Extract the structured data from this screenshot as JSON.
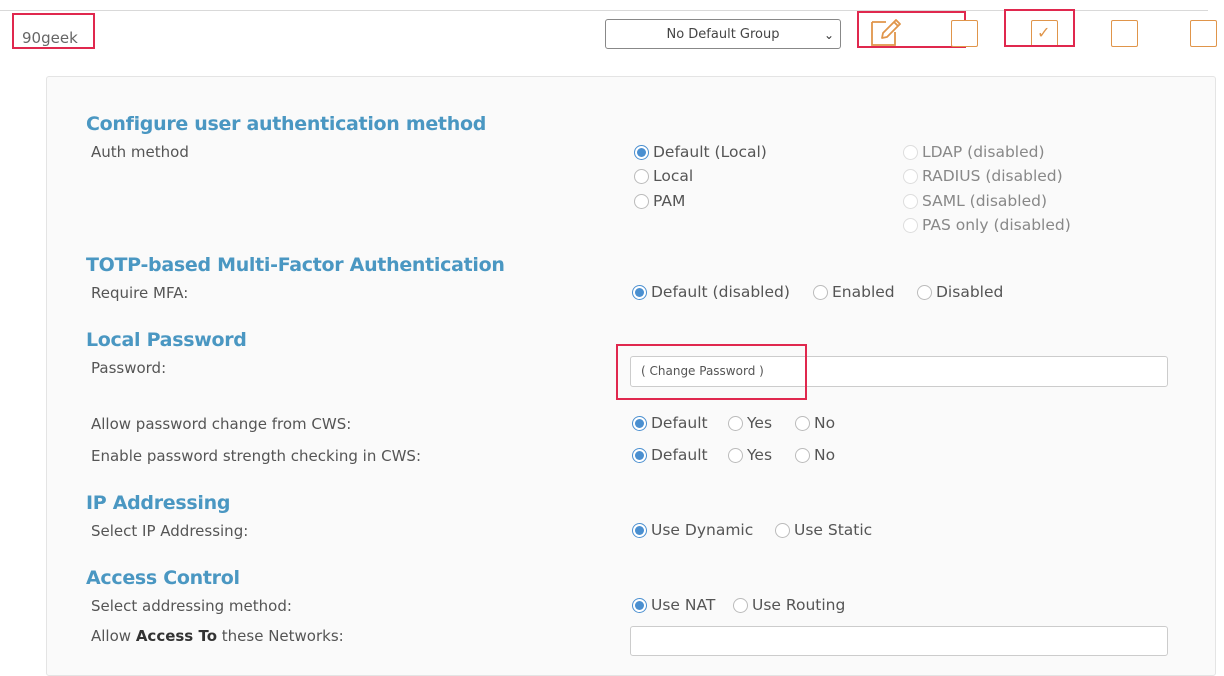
{
  "user": {
    "name": "90geek"
  },
  "group_select": {
    "value": "No Default Group"
  },
  "row_checkboxes": [
    false,
    true,
    false,
    false
  ],
  "sections": {
    "auth": {
      "title": "Configure user authentication method",
      "label": "Auth method",
      "options_left": [
        "Default (Local)",
        "Local",
        "PAM"
      ],
      "options_right": [
        "LDAP (disabled)",
        "RADIUS (disabled)",
        "SAML (disabled)",
        "PAS only (disabled)"
      ]
    },
    "mfa": {
      "title": "TOTP-based Multi-Factor Authentication",
      "label": "Require MFA:",
      "options": [
        "Default (disabled)",
        "Enabled",
        "Disabled"
      ]
    },
    "password": {
      "title": "Local Password",
      "label": "Password:",
      "change_link": "( Change Password )",
      "allow_change_label": "Allow password change from CWS:",
      "allow_change_options": [
        "Default",
        "Yes",
        "No"
      ],
      "strength_label": "Enable password strength checking in CWS:",
      "strength_options": [
        "Default",
        "Yes",
        "No"
      ]
    },
    "ip": {
      "title": "IP Addressing",
      "label": "Select IP Addressing:",
      "options": [
        "Use Dynamic",
        "Use Static"
      ]
    },
    "access": {
      "title": "Access Control",
      "label": "Select addressing method:",
      "options": [
        "Use NAT",
        "Use Routing"
      ],
      "allow_prefix": "Allow ",
      "allow_bold": "Access To",
      "allow_suffix": " these Networks:"
    }
  },
  "colors": {
    "accent": "#4a97c2",
    "checkbox": "#e0954a",
    "highlight": "#e0284e",
    "radio": "#4a8fd0"
  }
}
